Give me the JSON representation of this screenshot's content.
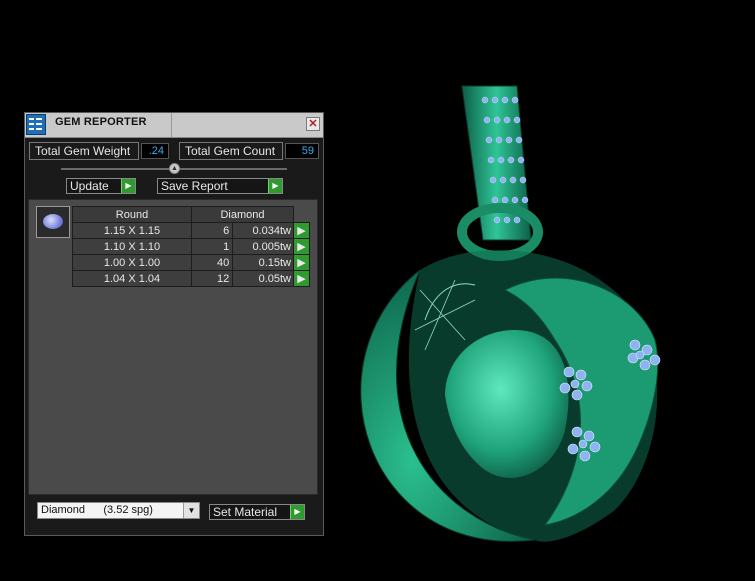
{
  "window": {
    "title": "GEM REPORTER",
    "close_glyph": "✕"
  },
  "stats": {
    "total_weight_label": "Total Gem Weight",
    "total_weight_value": ".24",
    "total_count_label": "Total Gem Count",
    "total_count_value": "59"
  },
  "buttons": {
    "update": "Update",
    "save_report": "Save Report",
    "set_material": "Set Material"
  },
  "gems": {
    "icon": "round-gem-icon",
    "headers": [
      "Round",
      "Diamond"
    ],
    "rows": [
      {
        "size": "1.15 X 1.15",
        "qty": "6",
        "weight": "0.034tw"
      },
      {
        "size": "1.10 X 1.10",
        "qty": "1",
        "weight": "0.005tw"
      },
      {
        "size": "1.00 X 1.00",
        "qty": "40",
        "weight": "0.15tw"
      },
      {
        "size": "1.04 X 1.04",
        "qty": "12",
        "weight": "0.05tw"
      }
    ]
  },
  "material": {
    "selected": "Diamond      (3.52 spg)"
  },
  "colors": {
    "accent_green": "#2f9a2f",
    "value_blue": "#3aaef2",
    "model_green": "#1fa37a",
    "gem_blue": "#8fb3f0"
  }
}
